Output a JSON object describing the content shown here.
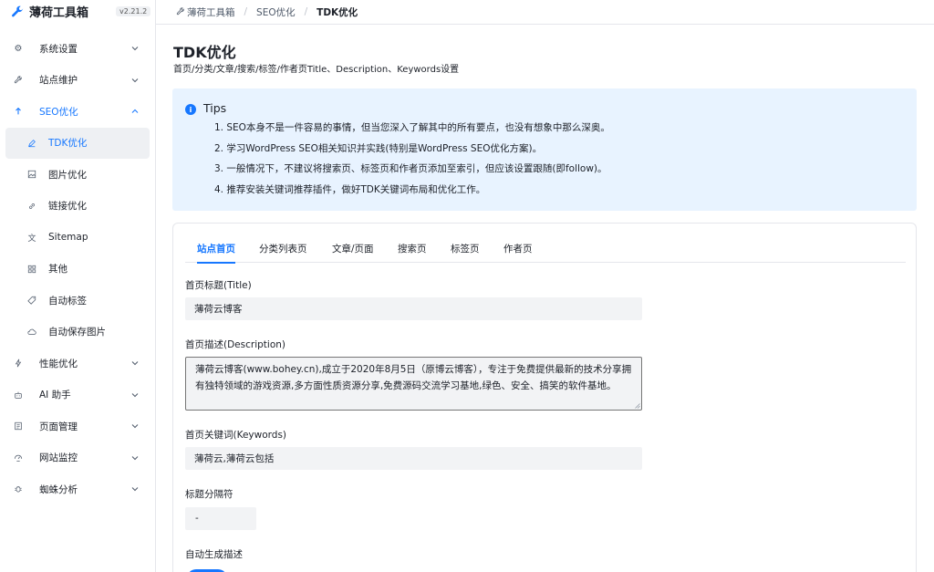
{
  "brand": {
    "name": "薄荷工具箱",
    "version": "v2.21.2"
  },
  "sidebar": {
    "items": [
      {
        "label": "系统设置",
        "icon": "gear-icon"
      },
      {
        "label": "站点维护",
        "icon": "wrench-icon"
      },
      {
        "label": "SEO优化",
        "icon": "arrow-up-icon"
      },
      {
        "label": "TDK优化",
        "icon": "pen-icon"
      },
      {
        "label": "图片优化",
        "icon": "image-icon"
      },
      {
        "label": "链接优化",
        "icon": "link-icon"
      },
      {
        "label": "Sitemap",
        "icon": "translate-icon"
      },
      {
        "label": "其他",
        "icon": "grid-icon"
      },
      {
        "label": "自动标签",
        "icon": "tag-icon"
      },
      {
        "label": "自动保存图片",
        "icon": "cloud-icon"
      },
      {
        "label": "性能优化",
        "icon": "bolt-icon"
      },
      {
        "label": "AI 助手",
        "icon": "robot-icon"
      },
      {
        "label": "页面管理",
        "icon": "file-icon"
      },
      {
        "label": "网站监控",
        "icon": "monitor-icon"
      },
      {
        "label": "蜘蛛分析",
        "icon": "bug-icon"
      }
    ]
  },
  "breadcrumb": {
    "root": "薄荷工具箱",
    "parent": "SEO优化",
    "current": "TDK优化"
  },
  "page": {
    "title": "TDK优化",
    "subtitle": "首页/分类/文章/搜索/标签/作者页Title、Description、Keywords设置"
  },
  "tips": {
    "title": "Tips",
    "items": [
      "1. SEO本身不是一件容易的事情，但当您深入了解其中的所有要点，也没有想象中那么深奥。",
      "2. 学习WordPress SEO相关知识并实践(特别是WordPress SEO优化方案)。",
      "3. 一般情况下，不建议将搜索页、标签页和作者页添加至索引，但应该设置跟随(即follow)。",
      "4. 推荐安装关键词推荐插件，做好TDK关键词布局和优化工作。"
    ]
  },
  "tabs": [
    "站点首页",
    "分类列表页",
    "文章/页面",
    "搜索页",
    "标签页",
    "作者页"
  ],
  "form": {
    "title_label": "首页标题(Title)",
    "title_value": "薄荷云博客",
    "desc_label": "首页描述(Description)",
    "desc_value": "薄荷云博客(www.bohey.cn),成立于2020年8月5日（原博云博客），专注于免费提供最新的技术分享拥有独特领域的游戏资源,多方面性质资源分享,免费源码交流学习基地,绿色、安全、搞笑的软件基地。",
    "keywords_label": "首页关键词(Keywords)",
    "keywords_value": "薄荷云,薄荷云包括",
    "separator_label": "标题分隔符",
    "separator_value": "-",
    "auto_desc_label": "自动生成描述",
    "auto_desc_enabled": true
  },
  "colors": {
    "accent": "#1677ff",
    "tips_bg": "#e8f3ff",
    "input_bg": "#f2f3f5"
  }
}
